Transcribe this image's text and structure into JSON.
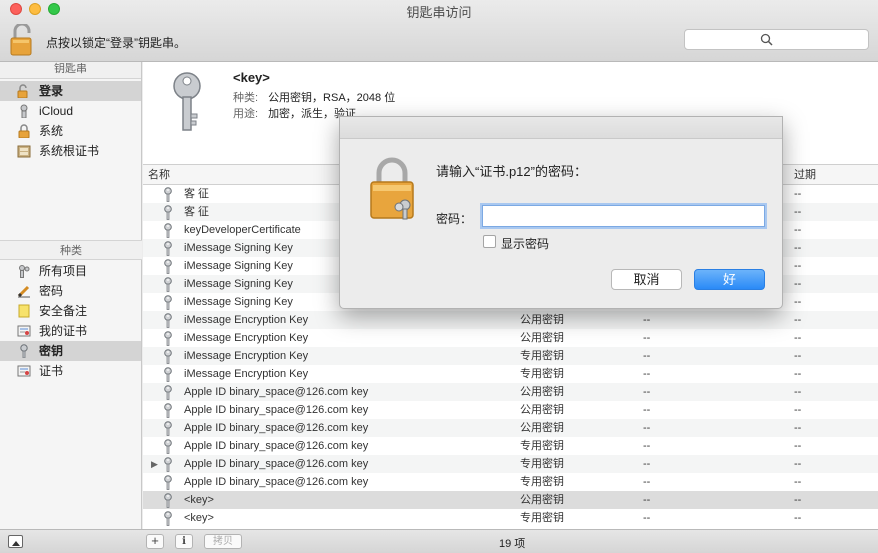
{
  "window": {
    "title": "钥匙串访问"
  },
  "toolbar": {
    "lock_text": "点按以锁定“登录”钥匙串。",
    "search_placeholder": ""
  },
  "sidebar": {
    "keychains_header": "钥匙串",
    "keychains": [
      {
        "label": "登录",
        "icon": "open-lock-icon",
        "selected": true
      },
      {
        "label": "iCloud",
        "icon": "person-icon",
        "selected": false
      },
      {
        "label": "系统",
        "icon": "lock-icon",
        "selected": false
      },
      {
        "label": "系统根证书",
        "icon": "folder-cabinet-icon",
        "selected": false
      }
    ],
    "category_header": "种类",
    "categories": [
      {
        "label": "所有项目",
        "icon": "people-icon",
        "selected": false
      },
      {
        "label": "密码",
        "icon": "pencil-icon",
        "selected": false
      },
      {
        "label": "安全备注",
        "icon": "note-icon",
        "selected": false
      },
      {
        "label": "我的证书",
        "icon": "certificate-icon",
        "selected": false
      },
      {
        "label": "密钥",
        "icon": "key-icon",
        "selected": true
      },
      {
        "label": "证书",
        "icon": "certificate-icon",
        "selected": false
      }
    ]
  },
  "info": {
    "name": "<key>",
    "type_label": "种类:",
    "type_value": "公用密钥，RSA，2048 位",
    "usage_label": "用途:",
    "usage_value": "加密，派生，验证"
  },
  "table": {
    "columns": {
      "name": "名称",
      "expires": "过期"
    },
    "rows": [
      {
        "name": "客 征",
        "kind": "",
        "c3": "",
        "c4": "--"
      },
      {
        "name": "客 征",
        "kind": "",
        "c3": "",
        "c4": "--"
      },
      {
        "name": "keyDeveloperCertificate",
        "kind": "",
        "c3": "",
        "c4": "--"
      },
      {
        "name": "iMessage Signing Key",
        "kind": "",
        "c3": "",
        "c4": "--"
      },
      {
        "name": "iMessage Signing Key",
        "kind": "",
        "c3": "",
        "c4": "--"
      },
      {
        "name": "iMessage Signing Key",
        "kind": "",
        "c3": "",
        "c4": "--"
      },
      {
        "name": "iMessage Signing Key",
        "kind": "",
        "c3": "",
        "c4": "--"
      },
      {
        "name": "iMessage Encryption Key",
        "kind": "公用密钥",
        "c3": "--",
        "c4": "--"
      },
      {
        "name": "iMessage Encryption Key",
        "kind": "公用密钥",
        "c3": "--",
        "c4": "--"
      },
      {
        "name": "iMessage Encryption Key",
        "kind": "专用密钥",
        "c3": "--",
        "c4": "--"
      },
      {
        "name": "iMessage Encryption Key",
        "kind": "专用密钥",
        "c3": "--",
        "c4": "--"
      },
      {
        "name": "Apple ID binary_space@126.com key",
        "kind": "公用密钥",
        "c3": "--",
        "c4": "--"
      },
      {
        "name": "Apple ID binary_space@126.com key",
        "kind": "公用密钥",
        "c3": "--",
        "c4": "--"
      },
      {
        "name": "Apple ID binary_space@126.com key",
        "kind": "公用密钥",
        "c3": "--",
        "c4": "--"
      },
      {
        "name": "Apple ID binary_space@126.com key",
        "kind": "专用密钥",
        "c3": "--",
        "c4": "--"
      },
      {
        "name": "Apple ID binary_space@126.com key",
        "kind": "专用密钥",
        "c3": "--",
        "c4": "--",
        "expandable": true
      },
      {
        "name": "Apple ID binary_space@126.com key",
        "kind": "专用密钥",
        "c3": "--",
        "c4": "--"
      },
      {
        "name": "<key>",
        "kind": "公用密钥",
        "c3": "--",
        "c4": "--",
        "selected": true
      },
      {
        "name": "<key>",
        "kind": "专用密钥",
        "c3": "--",
        "c4": "--"
      }
    ]
  },
  "statusbar": {
    "copy_label": "拷贝",
    "count": "19 项"
  },
  "dialog": {
    "title": "请输入“证书.p12”的密码：",
    "password_label": "密码：",
    "password_value": "",
    "show_password_label": "显示密码",
    "cancel_label": "取消",
    "ok_label": "好"
  },
  "colors": {
    "accent": "#2a8af7",
    "selection": "#d4d4d4"
  }
}
